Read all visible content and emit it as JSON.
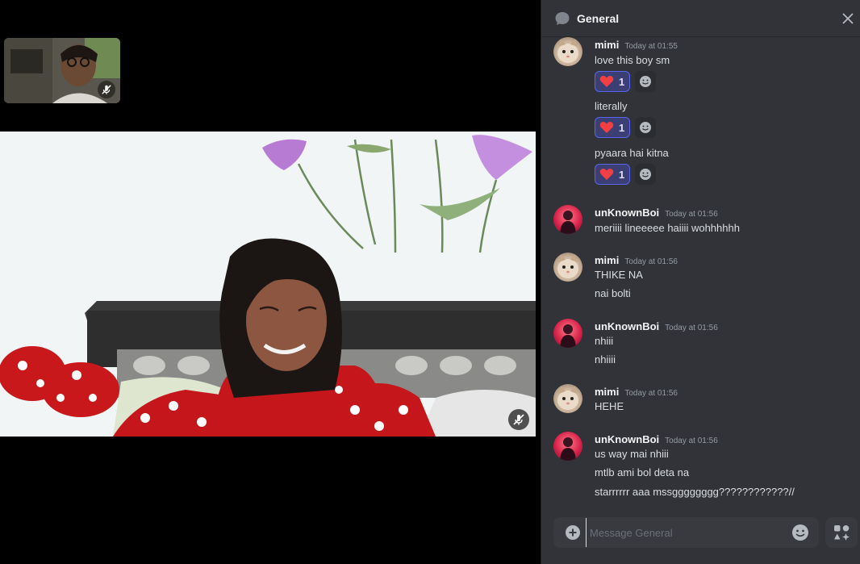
{
  "call": {
    "self_tile": {
      "muted": true,
      "mute_icon": "mic-muted-icon"
    },
    "main_video": {
      "muted": true,
      "mute_icon": "mic-muted-icon"
    }
  },
  "chat": {
    "channel_icon": "chat-bubble-icon",
    "title": "General",
    "close_icon": "close-icon",
    "messages": [
      {
        "user": "mimi",
        "time": "Today at 01:55",
        "lines": [
          "love this boy sm",
          "literally",
          "pyaara hai kitna"
        ],
        "reactions": [
          {
            "emoji": "heart",
            "count": "1"
          },
          {
            "emoji": "heart",
            "count": "1"
          },
          {
            "emoji": "heart",
            "count": "1"
          }
        ]
      },
      {
        "user": "unKnownBoi",
        "time": "Today at 01:56",
        "lines": [
          "meriiii lineeeee haiiii wohhhhhh"
        ]
      },
      {
        "user": "mimi",
        "time": "Today at 01:56",
        "lines": [
          "THIKE NA",
          "nai bolti"
        ]
      },
      {
        "user": "unKnownBoi",
        "time": "Today at 01:56",
        "lines": [
          "nhiii",
          "nhiiii"
        ]
      },
      {
        "user": "mimi",
        "time": "Today at 01:56",
        "lines": [
          "HEHE"
        ]
      },
      {
        "user": "unKnownBoi",
        "time": "Today at 01:56",
        "lines": [
          "us way mai nhiii",
          "mtlb ami bol deta na",
          "starrrrrr aaa mssgggggggg????????????//"
        ]
      }
    ],
    "composer": {
      "placeholder": "Message General",
      "value": "",
      "plus_icon": "plus-circle-icon",
      "emoji_icon": "emoji-icon"
    },
    "apps_icon": "apps-icon"
  },
  "colors": {
    "panel_bg": "#313338",
    "reaction_bg": "#3b3f73",
    "reaction_border": "#5865f2",
    "heart": "#f23f43"
  }
}
